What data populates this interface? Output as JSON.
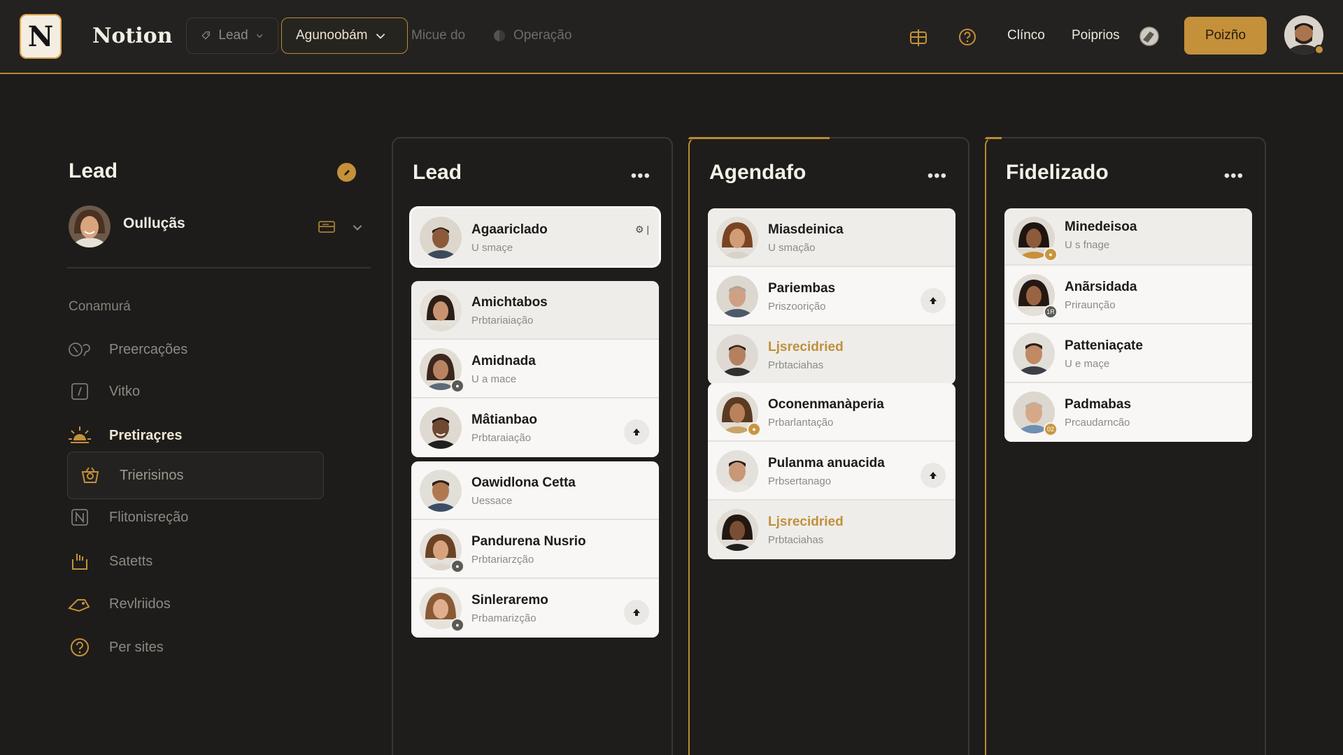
{
  "app": {
    "title": "Notion",
    "logo_letter": "N"
  },
  "topbar": {
    "lead_pill": "Lead",
    "agenda_pill": "Agunoobám",
    "link_1": "Micue do",
    "link_2": "Operação",
    "nav_1": "Clínco",
    "nav_2": "Poiprios",
    "primary_button": "Poizño"
  },
  "sidebar": {
    "heading": "Lead",
    "user_name": "Oulluçãs",
    "section_label": "Conamurá",
    "items": [
      {
        "label": "Preercações",
        "icon": "users-icon"
      },
      {
        "label": "Vitko",
        "icon": "slash-box-icon"
      },
      {
        "label": "Pretiraçres",
        "icon": "sun-icon"
      },
      {
        "label": "Trierisinos",
        "icon": "basket-icon"
      },
      {
        "label": "Flitonisreção",
        "icon": "notion-n-icon"
      },
      {
        "label": "Satetts",
        "icon": "tray-icon"
      },
      {
        "label": "Revlriidos",
        "icon": "tag-icon"
      },
      {
        "label": "Per sites",
        "icon": "help-icon"
      }
    ]
  },
  "columns": [
    {
      "title": "Lead",
      "groups": [
        [
          {
            "title": "Agaariclado",
            "sub": "U smaçe",
            "corner": "⚙ |"
          }
        ],
        [
          {
            "title": "Amichtabos",
            "sub": "Prbtariaiação"
          },
          {
            "title": "Amidnada",
            "sub": "U a mace"
          },
          {
            "title": "Mâtianbao",
            "sub": "Prbtaraiação"
          }
        ],
        [
          {
            "title": "Oawidlona Cetta",
            "sub": "Uessace"
          },
          {
            "title": "Pandurena Nusrio",
            "sub": "Prbtariarzção"
          },
          {
            "title": "Sinleraremo",
            "sub": "Prbamarizção"
          }
        ]
      ]
    },
    {
      "title": "Agendafo",
      "groups": [
        [
          {
            "title": "Miasdeinica",
            "sub": "U smação"
          },
          {
            "title": "Pariembas",
            "sub": "Priszoorição"
          },
          {
            "title": "Ljsrecidried",
            "sub": "Prbtaciahas"
          }
        ],
        [
          {
            "title": "Oconenmanàperia",
            "sub": "Prbarlantação"
          },
          {
            "title": "Pulanma anuacida",
            "sub": "Prbsertanago"
          },
          {
            "title": "Ljsrecidried",
            "sub": "Prbtaciahas"
          }
        ]
      ]
    },
    {
      "title": "Fidelizado",
      "groups": [
        [
          {
            "title": "Minedeisoa",
            "sub": "U s fnage"
          },
          {
            "title": "Anãrsidada",
            "sub": "Priraunção",
            "badge": "1R"
          },
          {
            "title": "Patteniaçate",
            "sub": "U e maçe"
          },
          {
            "title": "Padmabas",
            "sub": "Prcaudarncão",
            "badge": "02"
          }
        ]
      ]
    }
  ],
  "colors": {
    "accent": "#c4913a",
    "background": "#1d1c1a",
    "card": "#f8f7f5"
  }
}
